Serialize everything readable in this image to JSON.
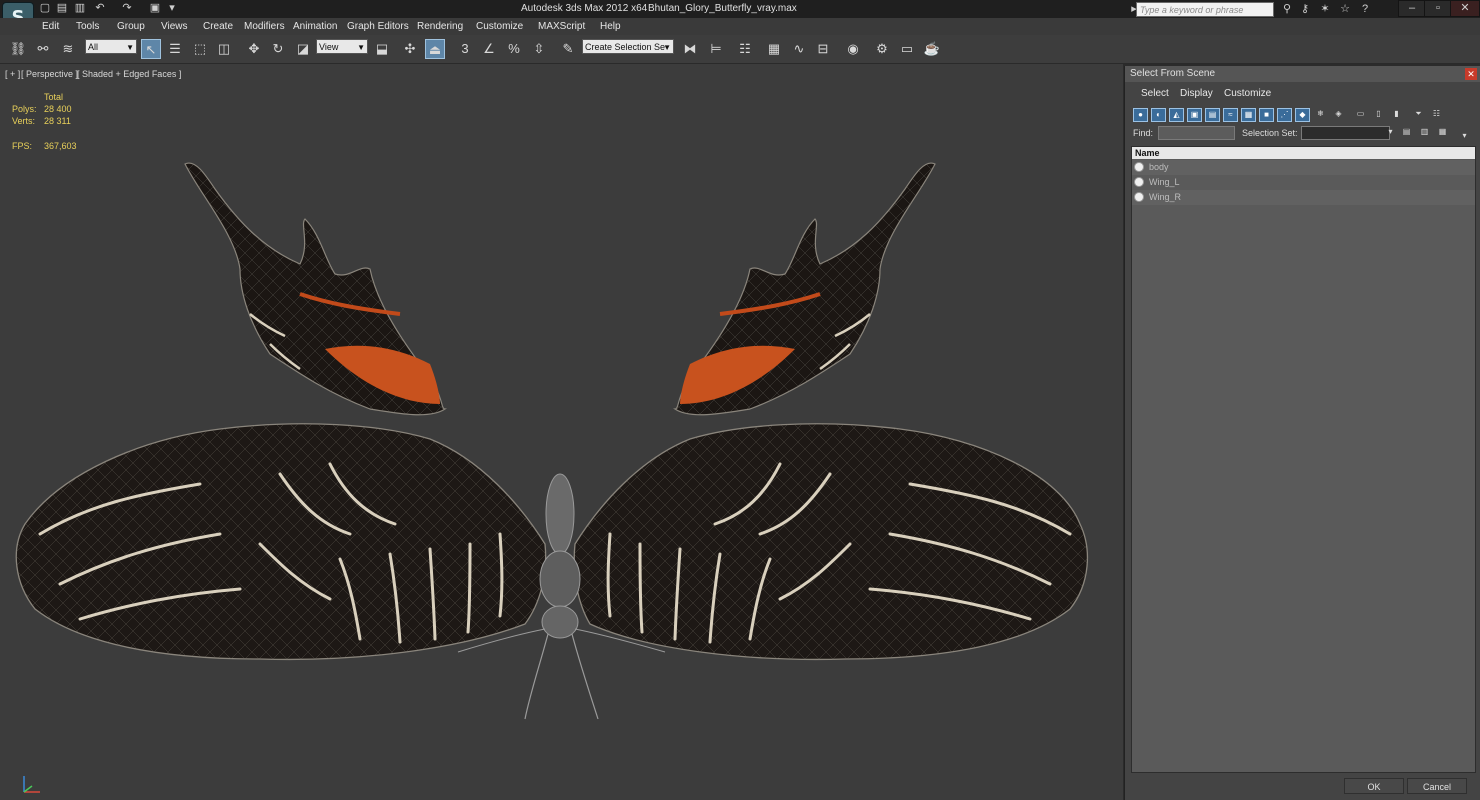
{
  "app": {
    "title": "Autodesk 3ds Max  2012 x64",
    "filename": "Bhutan_Glory_Butterfly_vray.max",
    "logo_glyph": "S",
    "search_placeholder": "Type a keyword or phrase"
  },
  "menu": [
    "Edit",
    "Tools",
    "Group",
    "Views",
    "Create",
    "Modifiers",
    "Animation",
    "Graph Editors",
    "Rendering",
    "Customize",
    "MAXScript",
    "Help"
  ],
  "toolbar": {
    "selection_filter": "All",
    "reference_coord": "View",
    "selection_set_placeholder": "Create Selection Se",
    "snap_label": "3",
    "angle_snap_label": "%"
  },
  "viewport": {
    "label_plus": "[ + ]",
    "label_view": "[ Perspective ]",
    "label_shading": "[ Shaded + Edged Faces ]",
    "stats": {
      "header": "Total",
      "polys_label": "Polys:",
      "polys_value": "28 400",
      "verts_label": "Verts:",
      "verts_value": "28 311",
      "fps_label": "FPS:",
      "fps_value": "367,603"
    }
  },
  "panel": {
    "title": "Select From Scene",
    "menu": [
      "Select",
      "Display",
      "Customize"
    ],
    "find_label": "Find:",
    "selection_set_label": "Selection Set:",
    "column_name": "Name",
    "objects": [
      "body",
      "Wing_L",
      "Wing_R"
    ],
    "ok_label": "OK",
    "cancel_label": "Cancel"
  },
  "colors": {
    "viewport_bg": "#3c3c3c",
    "stats_text": "#e8d05a",
    "wing_orange": "#c8521e",
    "wing_dark": "#1a1512",
    "wing_stripe": "#d9d0bd"
  }
}
